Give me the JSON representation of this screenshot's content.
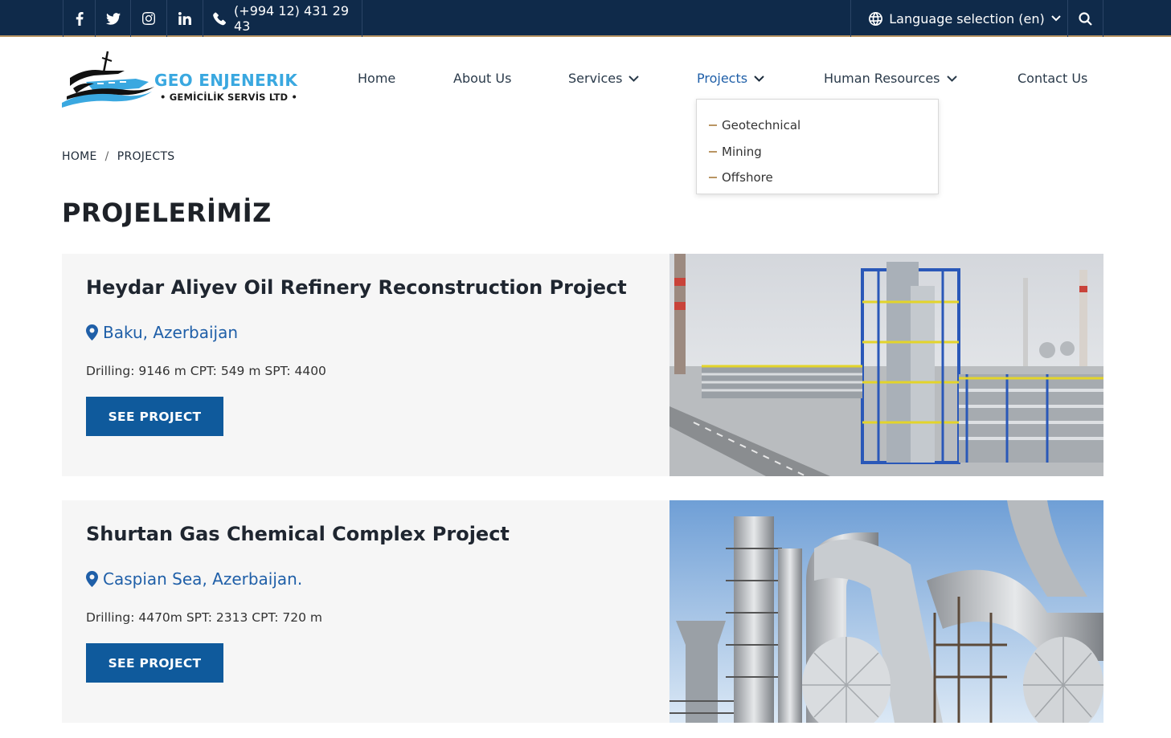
{
  "topbar": {
    "phone": "(+994 12) 431 29 43",
    "language": "Language selection (en)"
  },
  "logo": {
    "brand": "GEO ENJENERIK",
    "sub": "• GEMİCİLİK SERVİS LTD •"
  },
  "nav": {
    "items": [
      {
        "label": "Home"
      },
      {
        "label": "About Us"
      },
      {
        "label": "Services"
      },
      {
        "label": "Projects"
      },
      {
        "label": "Human Resources"
      },
      {
        "label": "Contact Us"
      }
    ],
    "projects_dropdown": [
      {
        "label": "Geotechnical"
      },
      {
        "label": "Mining"
      },
      {
        "label": "Offshore"
      }
    ]
  },
  "breadcrumb": {
    "home": "HOME",
    "sep": "/",
    "current": "PROJECTS"
  },
  "page": {
    "title": "PROJELERİMİZ"
  },
  "projects": [
    {
      "title": "Heydar Aliyev Oil Refinery Reconstruction Project",
      "location": "Baku, Azerbaijan",
      "stats": "Drilling: 9146 m CPT: 549 m SPT: 4400",
      "button": "SEE PROJECT"
    },
    {
      "title": "Shurtan Gas Chemical Complex Project",
      "location": "Caspian Sea, Azerbaijan.",
      "stats": "Drilling: 4470m SPT: 2313 CPT: 720 m",
      "button": "SEE PROJECT"
    }
  ],
  "colors": {
    "topbar": "#0f2a4a",
    "accent_gold": "#b99563",
    "link_blue": "#1f5fa8",
    "button_blue": "#0f5a9c",
    "logo_blue": "#3aa8e0"
  }
}
